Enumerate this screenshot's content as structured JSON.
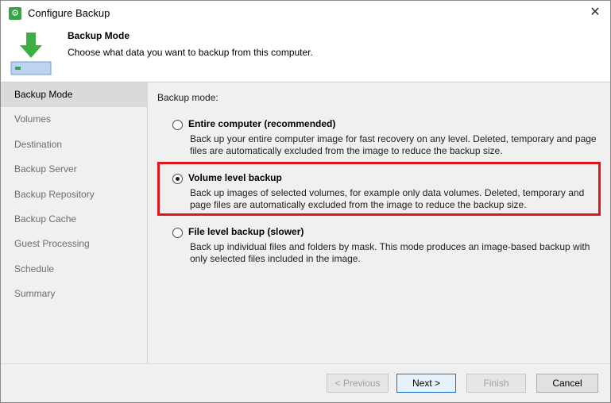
{
  "window": {
    "title": "Configure Backup",
    "close_glyph": "✕"
  },
  "header": {
    "title": "Backup Mode",
    "subtitle": "Choose what data you want to backup from this computer.",
    "icon": "backup-drive-icon"
  },
  "sidebar": {
    "items": [
      {
        "label": "Backup Mode",
        "active": true
      },
      {
        "label": "Volumes"
      },
      {
        "label": "Destination"
      },
      {
        "label": "Backup Server"
      },
      {
        "label": "Backup Repository"
      },
      {
        "label": "Backup Cache"
      },
      {
        "label": "Guest Processing"
      },
      {
        "label": "Schedule"
      },
      {
        "label": "Summary"
      }
    ]
  },
  "main": {
    "section_label": "Backup mode:",
    "options": [
      {
        "label": "Entire computer (recommended)",
        "description": "Back up your entire computer image for fast recovery on any level. Deleted, temporary and page files are automatically excluded from the image to reduce the backup size.",
        "selected": false
      },
      {
        "label": "Volume level backup",
        "description": "Back up images of selected volumes, for example only data volumes. Deleted, temporary and page files are automatically excluded from the image to reduce the backup size.",
        "selected": true
      },
      {
        "label": "File level backup (slower)",
        "description": "Back up individual files and folders by mask. This mode produces an image-based backup with only selected files included in the image.",
        "selected": false
      }
    ],
    "highlight_color": "#e0161a"
  },
  "footer": {
    "previous_label": "< Previous",
    "next_label": "Next >",
    "finish_label": "Finish",
    "cancel_label": "Cancel"
  }
}
